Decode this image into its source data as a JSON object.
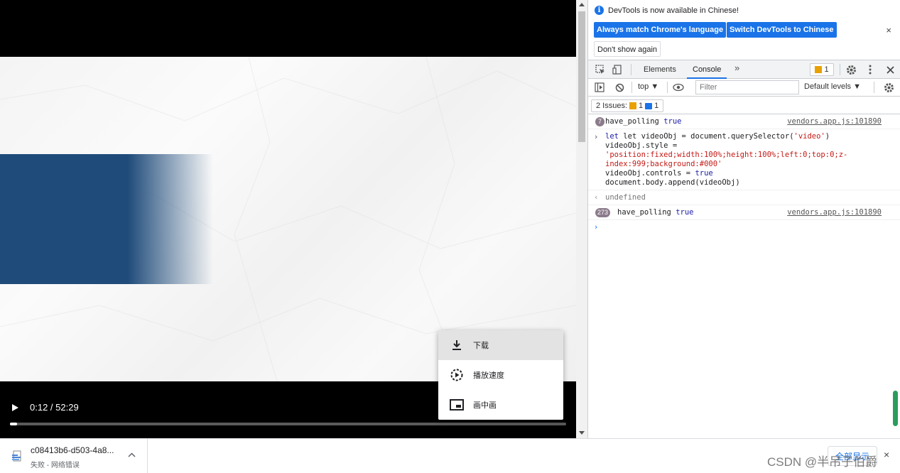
{
  "video": {
    "time": "0:12 / 52:29",
    "progress_fraction": 0.012,
    "menu": [
      {
        "label": "下载",
        "icon": "download-icon",
        "active": true
      },
      {
        "label": "播放速度",
        "icon": "playback-speed-icon",
        "active": false
      },
      {
        "label": "画中画",
        "icon": "picture-in-picture-icon",
        "active": false
      }
    ]
  },
  "devtools": {
    "info": {
      "message": "DevTools is now available in Chinese!",
      "match_button": "Always match Chrome's language",
      "switch_button": "Switch DevTools to Chinese",
      "dismiss_button": "Don't show again",
      "close": "×"
    },
    "tabs": [
      "Elements",
      "Console"
    ],
    "active_tab": "Console",
    "more_tabs": "»",
    "warning_count": "1",
    "filterbar": {
      "context": "top ▼",
      "filter_placeholder": "Filter",
      "levels": "Default levels ▼"
    },
    "issues": {
      "label": "2 Issues:",
      "warnings": "1",
      "infos": "1"
    },
    "console": {
      "row1": {
        "count": "7",
        "text": "have_polling",
        "value": "true",
        "source": "vendors.app.js:101890"
      },
      "input_lines": [
        "let videoObj = document.querySelector(",
        "'video'",
        ")",
        "videoObj.style =",
        "'position:fixed;width:100%;height:100%;left:0;top:0;z-",
        "index:999;background:#000'",
        "videoObj.controls = ",
        "true",
        "document.body.append(videoObj)"
      ],
      "output": "undefined",
      "row2": {
        "count": "273",
        "text": "have_polling",
        "value": "true",
        "source": "vendors.app.js:101890"
      }
    }
  },
  "shelf": {
    "filename": "c08413b6-d503-4a8...",
    "status": "失败 - 网络错误",
    "show_all": "全部显示",
    "close": "×",
    "watermark": "CSDN @半吊子伯爵"
  },
  "colors": {
    "accent": "#1a73e8",
    "video_blue": "#1f4b7a",
    "warning": "#e8a100",
    "scroll_green": "#2a9d5c"
  }
}
